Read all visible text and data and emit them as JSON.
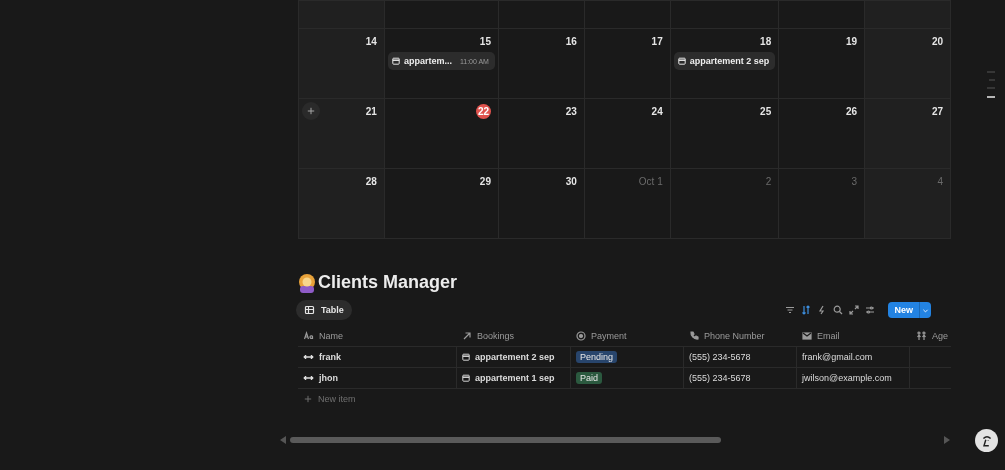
{
  "calendar": {
    "weeks": [
      {
        "days": [
          {
            "day": "14",
            "muted": false,
            "today": false,
            "add": false
          },
          {
            "day": "15",
            "muted": false,
            "today": false,
            "add": false,
            "events": [
              {
                "title": "appartem...",
                "time": "11:00 AM"
              }
            ]
          },
          {
            "day": "16",
            "muted": false,
            "today": false,
            "add": false
          },
          {
            "day": "17",
            "muted": false,
            "today": false,
            "add": false
          },
          {
            "day": "18",
            "muted": false,
            "today": false,
            "add": false,
            "events": [
              {
                "title": "appartement 2 sep"
              }
            ]
          },
          {
            "day": "19",
            "muted": false,
            "today": false,
            "add": false
          },
          {
            "day": "20",
            "muted": false,
            "today": false,
            "add": false
          }
        ]
      },
      {
        "days": [
          {
            "day": "21",
            "muted": false,
            "today": false,
            "add": true
          },
          {
            "day": "22",
            "muted": false,
            "today": true,
            "add": false
          },
          {
            "day": "23",
            "muted": false,
            "today": false,
            "add": false
          },
          {
            "day": "24",
            "muted": false,
            "today": false,
            "add": false
          },
          {
            "day": "25",
            "muted": false,
            "today": false,
            "add": false
          },
          {
            "day": "26",
            "muted": false,
            "today": false,
            "add": false
          },
          {
            "day": "27",
            "muted": false,
            "today": false,
            "add": false
          }
        ]
      },
      {
        "days": [
          {
            "day": "28",
            "muted": false,
            "today": false,
            "add": false
          },
          {
            "day": "29",
            "muted": false,
            "today": false,
            "add": false
          },
          {
            "day": "30",
            "muted": false,
            "today": false,
            "add": false
          },
          {
            "day": "Oct 1",
            "muted": true,
            "today": false,
            "add": false
          },
          {
            "day": "2",
            "muted": true,
            "today": false,
            "add": false
          },
          {
            "day": "3",
            "muted": true,
            "today": false,
            "add": false
          },
          {
            "day": "4",
            "muted": true,
            "today": false,
            "add": false
          }
        ]
      }
    ]
  },
  "database": {
    "title": "Clients Manager",
    "view_tab": {
      "label": "Table",
      "selected": true
    },
    "toolbar": [
      {
        "kind": "filter",
        "active": false
      },
      {
        "kind": "sort",
        "active": true
      },
      {
        "kind": "automation",
        "active": false
      },
      {
        "kind": "search",
        "active": false
      },
      {
        "kind": "expand",
        "active": false
      },
      {
        "kind": "settings",
        "active": false
      }
    ],
    "new_button": "New",
    "columns": [
      {
        "kind": "title",
        "label": "Name"
      },
      {
        "kind": "relation",
        "label": "Bookings"
      },
      {
        "kind": "status",
        "label": "Payment"
      },
      {
        "kind": "phone",
        "label": "Phone Number"
      },
      {
        "kind": "email",
        "label": "Email"
      },
      {
        "kind": "person",
        "label": "Age"
      }
    ],
    "rows": [
      {
        "name": "frank",
        "booking": "appartement 2 sep",
        "payment": {
          "label": "Pending",
          "color": "#28456c"
        },
        "phone": "(555) 234-5678",
        "email": "frank@gmail.com"
      },
      {
        "name": "jhon",
        "booking": "appartement 1 sep",
        "payment": {
          "label": "Paid",
          "color": "#2b593f"
        },
        "phone": "(555) 234-5678",
        "email": "jwilson@example.com"
      }
    ],
    "new_item": "New item"
  }
}
